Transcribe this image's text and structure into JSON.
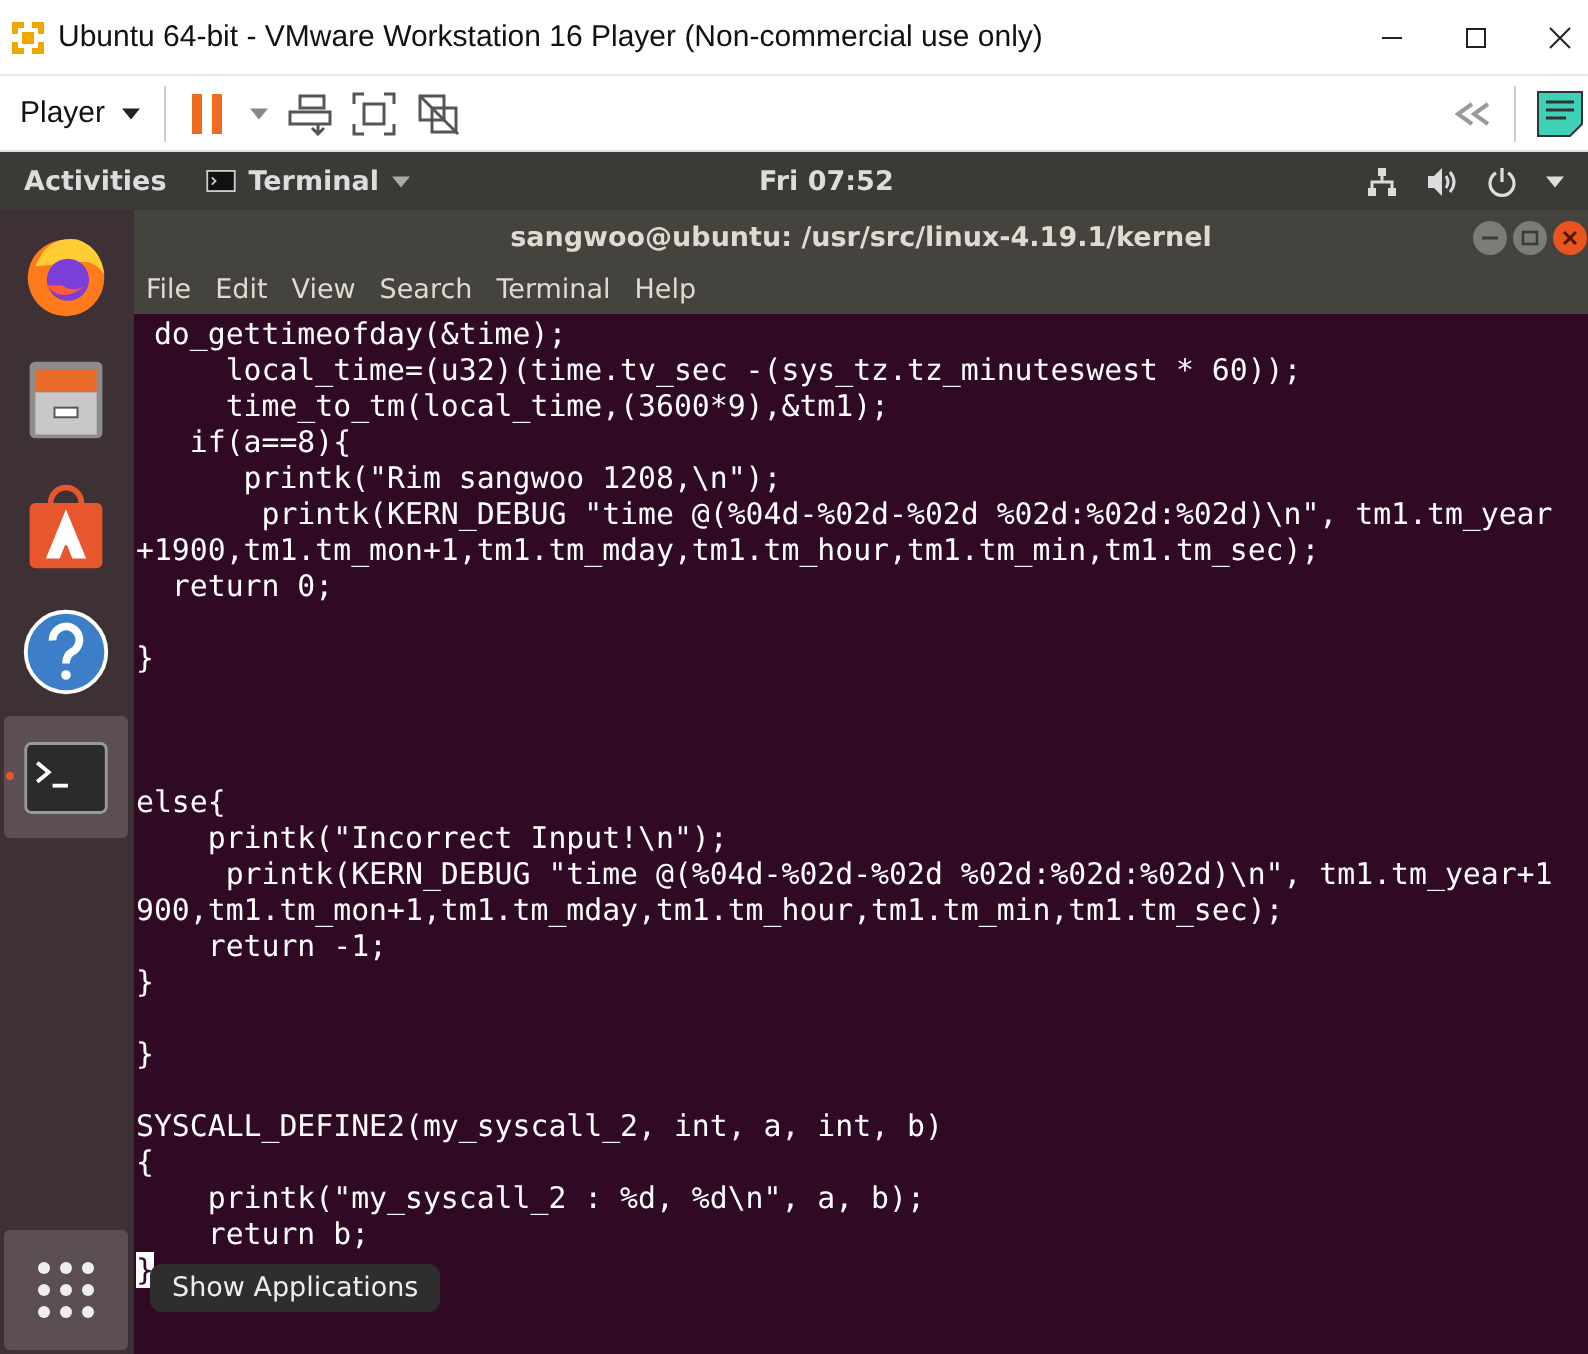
{
  "vmware_window": {
    "title": "Ubuntu 64-bit - VMware Workstation 16 Player (Non-commercial use only)"
  },
  "toolbar": {
    "player_menu": "Player"
  },
  "top_bar": {
    "activities": "Activities",
    "app_menu": "Terminal",
    "clock": "Fri 07:52"
  },
  "dock": {
    "items": [
      {
        "kind": "firefox",
        "selected": false
      },
      {
        "kind": "files",
        "selected": false
      },
      {
        "kind": "software",
        "selected": false
      },
      {
        "kind": "help",
        "selected": false
      },
      {
        "kind": "terminal",
        "selected": true
      }
    ],
    "show_apps": {
      "hovered": true,
      "tooltip": "Show Applications"
    }
  },
  "terminal": {
    "title": "sangwoo@ubuntu: /usr/src/linux-4.19.1/kernel",
    "menu": [
      "File",
      "Edit",
      "View",
      "Search",
      "Terminal",
      "Help"
    ],
    "output": " do_gettimeofday(&time);\n     local_time=(u32)(time.tv_sec -(sys_tz.tz_minuteswest * 60));\n     time_to_tm(local_time,(3600*9),&tm1);\n   if(a==8){\n      printk(\"Rim sangwoo 1208,\\n\");\n       printk(KERN_DEBUG \"time @(%04d-%02d-%02d %02d:%02d:%02d)\\n\", tm1.tm_year\n+1900,tm1.tm_mon+1,tm1.tm_mday,tm1.tm_hour,tm1.tm_min,tm1.tm_sec);\n  return 0;\n\n}\n\n\n\nelse{\n    printk(\"Incorrect Input!\\n\");\n     printk(KERN_DEBUG \"time @(%04d-%02d-%02d %02d:%02d:%02d)\\n\", tm1.tm_year+1\n900,tm1.tm_mon+1,tm1.tm_mday,tm1.tm_hour,tm1.tm_min,tm1.tm_sec);\n    return -1;\n}\n\n}\n\nSYSCALL_DEFINE2(my_syscall_2, int, a, int, b)\n{\n    printk(\"my_syscall_2 : %d, %d\\n\", a, b);\n    return b;",
    "cursor_line": "}"
  }
}
